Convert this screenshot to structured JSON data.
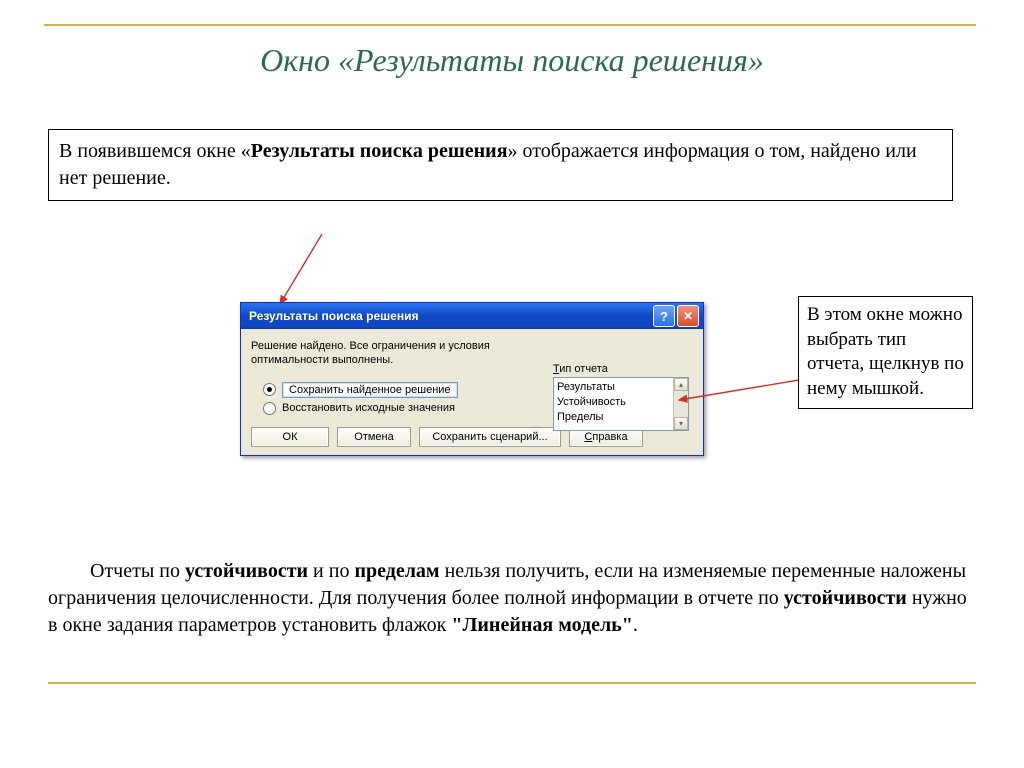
{
  "title": "Окно «Результаты  поиска решения»",
  "callout_top": {
    "pre": "В появившемся окне «",
    "bold": "Результаты поиска решения",
    "post": "» отображается информация о том, найдено или нет решение."
  },
  "callout_right": "В этом окне можно выбрать тип отчета, щелкнув по нему мышкой.",
  "dialog": {
    "title": "Результаты поиска решения",
    "status": "Решение найдено. Все ограничения и условия оптимальности выполнены.",
    "radio1": "Сохранить найденное решение",
    "radio2": "Восстановить исходные значения",
    "group_label_pre": "Т",
    "group_label_post": "ип отчета",
    "list": {
      "i0": "Результаты",
      "i1": "Устойчивость",
      "i2": "Пределы"
    },
    "buttons": {
      "ok": "ОК",
      "cancel": "Отмена",
      "save": "Сохранить сценарий...",
      "help_u": "С",
      "help_post": "правка"
    }
  },
  "footnote": {
    "t1": "Отчеты по ",
    "b1": "устойчивости",
    "t2": " и по ",
    "b2": "пределам",
    "t3": " нельзя получить, если на изменяемые переменные наложены ограничения целочисленности. Для получения более полной информации в отчете по ",
    "b3": "устойчивости",
    "t4": " нужно в окне задания параметров установить флажок ",
    "b4": "\"Линейная модель\"",
    "t5": "."
  }
}
